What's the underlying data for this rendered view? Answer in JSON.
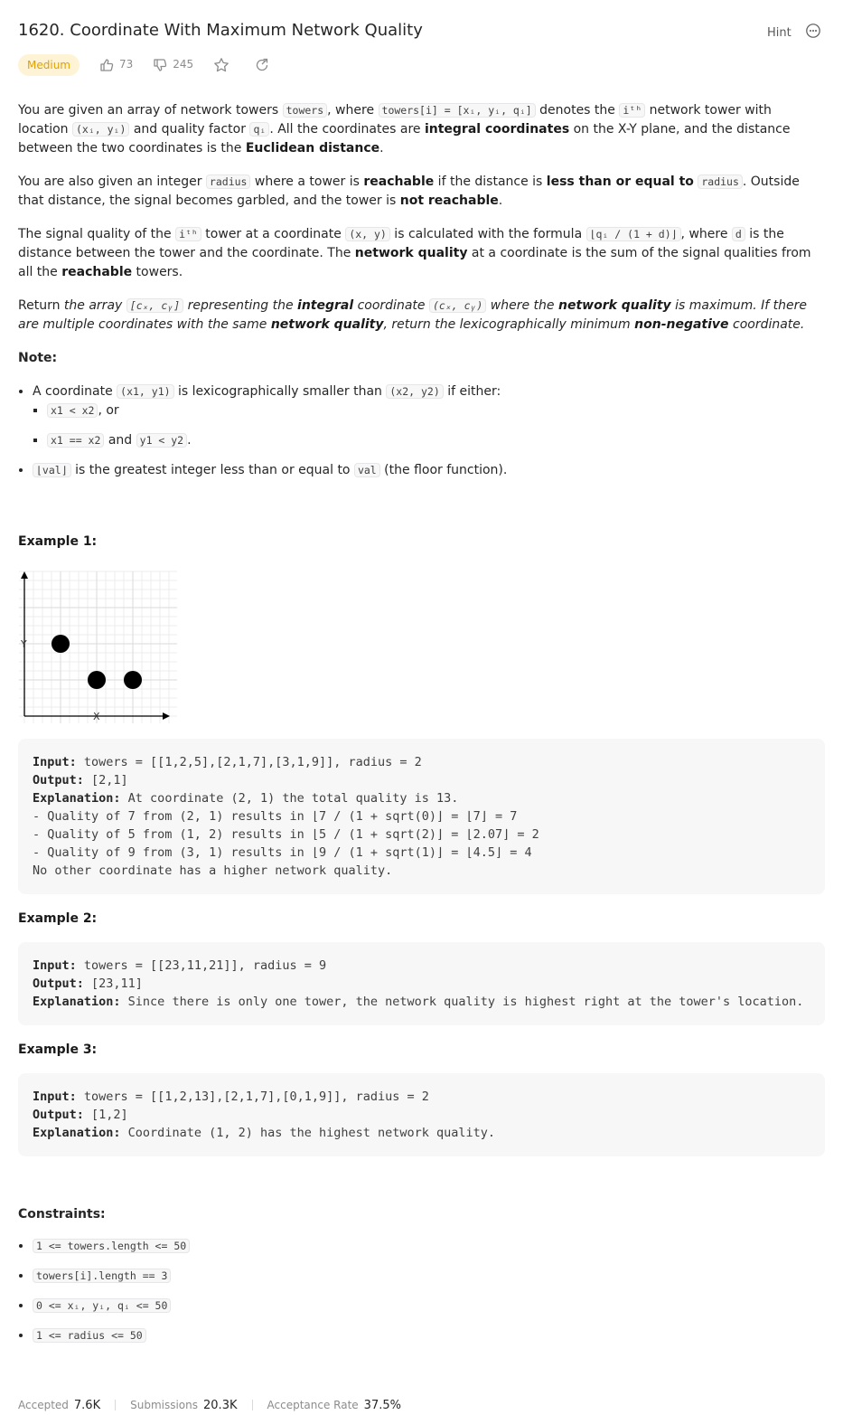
{
  "header": {
    "title": "1620. Coordinate With Maximum Network Quality",
    "hint": "Hint",
    "difficulty": "Medium",
    "likes": "73",
    "dislikes": "245"
  },
  "description": {
    "p1_a": "You are given an array of network towers ",
    "p1_code1": "towers",
    "p1_b": ", where ",
    "p1_code2": "towers[i] = [xᵢ, yᵢ, qᵢ]",
    "p1_c": " denotes the ",
    "p1_code3": "iᵗʰ",
    "p1_d": " network tower with location ",
    "p1_code4": "(xᵢ, yᵢ)",
    "p1_e": " and quality factor ",
    "p1_code5": "qᵢ",
    "p1_f": ". All the coordinates are ",
    "p1_b1": "integral coordinates",
    "p1_g": " on the X-Y plane, and the distance between the two coordinates is the ",
    "p1_b2": "Euclidean distance",
    "p1_h": ".",
    "p2_a": "You are also given an integer ",
    "p2_code1": "radius",
    "p2_b": " where a tower is ",
    "p2_b1": "reachable",
    "p2_c": " if the distance is ",
    "p2_b2": "less than or equal to",
    "p2_d": " ",
    "p2_code2": "radius",
    "p2_e": ". Outside that distance, the signal becomes garbled, and the tower is ",
    "p2_b3": "not reachable",
    "p2_f": ".",
    "p3_a": "The signal quality of the ",
    "p3_code1": "iᵗʰ",
    "p3_b": " tower at a coordinate ",
    "p3_code2": "(x, y)",
    "p3_c": " is calculated with the formula ",
    "p3_code3": "⌊qᵢ / (1 + d)⌋",
    "p3_d": ", where ",
    "p3_code4": "d",
    "p3_e": " is the distance between the tower and the coordinate. The ",
    "p3_b1": "network quality",
    "p3_f": " at a coordinate is the sum of the signal qualities from all the ",
    "p3_b2": "reachable",
    "p3_g": " towers.",
    "p4_a": "Return ",
    "p4_i1": "the array ",
    "p4_code1": "[cₓ, cᵧ]",
    "p4_i2": " representing the ",
    "p4_b1": "integral",
    "p4_i3": " coordinate ",
    "p4_code2": "(cₓ, cᵧ)",
    "p4_i4": " where the ",
    "p4_b2": "network quality",
    "p4_i5": " is maximum. If there are multiple coordinates with the same ",
    "p4_b3": "network quality",
    "p4_i6": ", return the lexicographically minimum ",
    "p4_b4": "non-negative",
    "p4_i7": " coordinate.",
    "note_title": "Note:",
    "n1_a": "A coordinate ",
    "n1_code1": "(x1, y1)",
    "n1_b": " is lexicographically smaller than ",
    "n1_code2": "(x2, y2)",
    "n1_c": " if either:",
    "n1s1_code": "x1 < x2",
    "n1s1_text": ", or",
    "n1s2_code1": "x1 == x2",
    "n1s2_text": " and ",
    "n1s2_code2": "y1 < y2",
    "n1s2_end": ".",
    "n2_code": "⌊val⌋",
    "n2_a": " is the greatest integer less than or equal to ",
    "n2_code2": "val",
    "n2_b": " (the floor function)."
  },
  "examples": {
    "ex1_title": "Example 1:",
    "ex1_axis_y": "Y",
    "ex1_axis_x": "X",
    "ex1_lines": [
      {
        "k": "Input:",
        "v": " towers = [[1,2,5],[2,1,7],[3,1,9]], radius = 2"
      },
      {
        "k": "Output:",
        "v": " [2,1]"
      },
      {
        "k": "Explanation:",
        "v": " At coordinate (2, 1) the total quality is 13."
      },
      {
        "k": "",
        "v": "- Quality of 7 from (2, 1) results in ⌊7 / (1 + sqrt(0)⌋ = ⌊7⌋ = 7"
      },
      {
        "k": "",
        "v": "- Quality of 5 from (1, 2) results in ⌊5 / (1 + sqrt(2)⌋ = ⌊2.07⌋ = 2"
      },
      {
        "k": "",
        "v": "- Quality of 9 from (3, 1) results in ⌊9 / (1 + sqrt(1)⌋ = ⌊4.5⌋ = 4"
      },
      {
        "k": "",
        "v": "No other coordinate has a higher network quality."
      }
    ],
    "ex2_title": "Example 2:",
    "ex2_lines": [
      {
        "k": "Input:",
        "v": " towers = [[23,11,21]], radius = 9"
      },
      {
        "k": "Output:",
        "v": " [23,11]"
      },
      {
        "k": "Explanation:",
        "v": " Since there is only one tower, the network quality is highest right at the tower's location."
      }
    ],
    "ex3_title": "Example 3:",
    "ex3_lines": [
      {
        "k": "Input:",
        "v": " towers = [[1,2,13],[2,1,7],[0,1,9]], radius = 2"
      },
      {
        "k": "Output:",
        "v": " [1,2]"
      },
      {
        "k": "Explanation:",
        "v": " Coordinate (1, 2) has the highest network quality."
      }
    ]
  },
  "constraints": {
    "title": "Constraints:",
    "items": [
      "1 <= towers.length <= 50",
      "towers[i].length == 3",
      "0 <= xᵢ, yᵢ, qᵢ <= 50",
      "1 <= radius <= 50"
    ]
  },
  "stats": {
    "accepted_label": "Accepted",
    "accepted_value": "7.6K",
    "submissions_label": "Submissions",
    "submissions_value": "20.3K",
    "rate_label": "Acceptance Rate",
    "rate_value": "37.5%"
  }
}
